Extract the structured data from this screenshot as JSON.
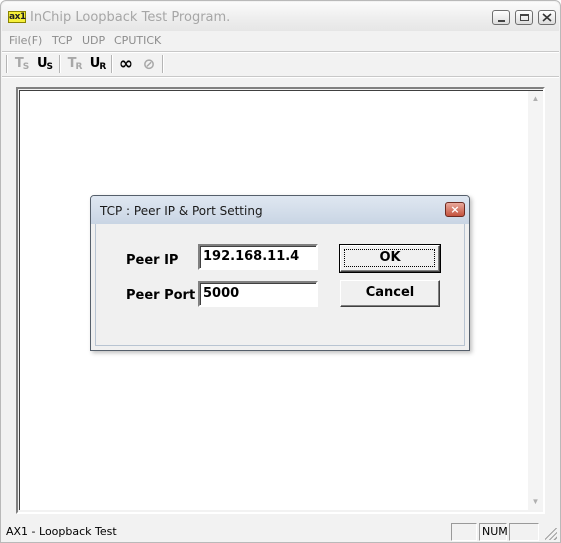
{
  "window": {
    "title": "InChip Loopback Test Program.",
    "icon_text": "ax1"
  },
  "menu": {
    "items": [
      "File(F)",
      "TCP",
      "UDP",
      "CPUTICK"
    ]
  },
  "toolbar": {
    "tcp_server": "T",
    "tcp_server_sub": "S",
    "udp_server": "U",
    "udp_server_sub": "S",
    "tcp_client": "T",
    "tcp_client_sub": "R",
    "udp_client": "U",
    "udp_client_sub": "R",
    "loop": "∞",
    "stop": "⊘"
  },
  "statusbar": {
    "text": "AX1 - Loopback Test",
    "num": "NUM"
  },
  "dialog": {
    "title": "TCP : Peer IP & Port Setting",
    "close_glyph": "×",
    "peer_ip_label": "Peer IP",
    "peer_ip_value": "192.168.11.4",
    "peer_port_label": "Peer Port",
    "peer_port_value": "5000",
    "ok_label": "OK",
    "cancel_label": "Cancel"
  },
  "icons": [
    "app-icon",
    "minimize-icon",
    "maximize-icon",
    "close-icon",
    "infinity-icon",
    "stop-icon",
    "scroll-up-icon",
    "scroll-down-icon",
    "size-grip-icon"
  ]
}
